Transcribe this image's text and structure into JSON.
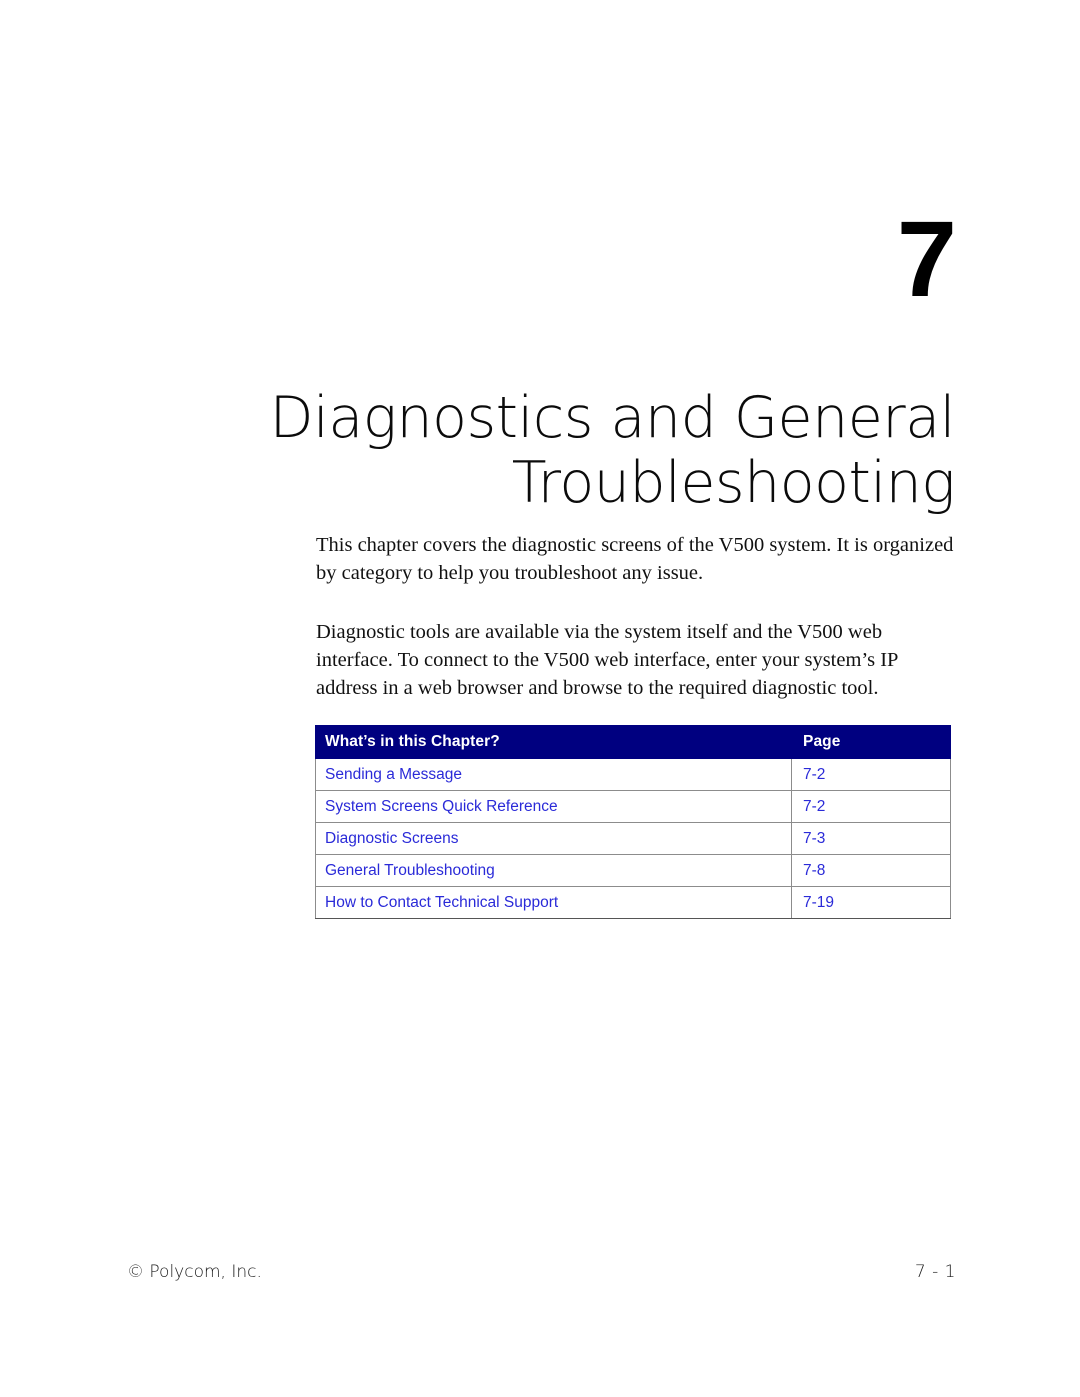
{
  "chapter": {
    "number": "7",
    "title_lines": [
      "Diagnostics and General",
      "Troubleshooting"
    ]
  },
  "intro": {
    "paragraph_1": "This chapter covers the diagnostic screens of the V500 system. It is organized by category to help you troubleshoot any issue.",
    "paragraph_2": "Diagnostic tools are available via the system itself and the V500 web interface. To connect to the V500 web interface, enter your system’s IP address in a web browser and browse to the required diagnostic tool."
  },
  "contents_table": {
    "headers": {
      "topic": "What’s in this Chapter?",
      "page": "Page"
    },
    "rows": [
      {
        "topic": "Sending a Message",
        "page": "7-2"
      },
      {
        "topic": "System Screens Quick Reference",
        "page": "7-2"
      },
      {
        "topic": "Diagnostic Screens",
        "page": "7-3"
      },
      {
        "topic": "General Troubleshooting",
        "page": "7-8"
      },
      {
        "topic": "How to Contact Technical Support",
        "page": "7-19"
      }
    ]
  },
  "footer": {
    "copyright": "© Polycom, Inc.",
    "page_number": "7 - 1"
  },
  "colors": {
    "header_navy": "#000080",
    "link_blue": "#2a2ad8",
    "text_black": "#000000",
    "row_border_gray": "#8c8c8c"
  }
}
